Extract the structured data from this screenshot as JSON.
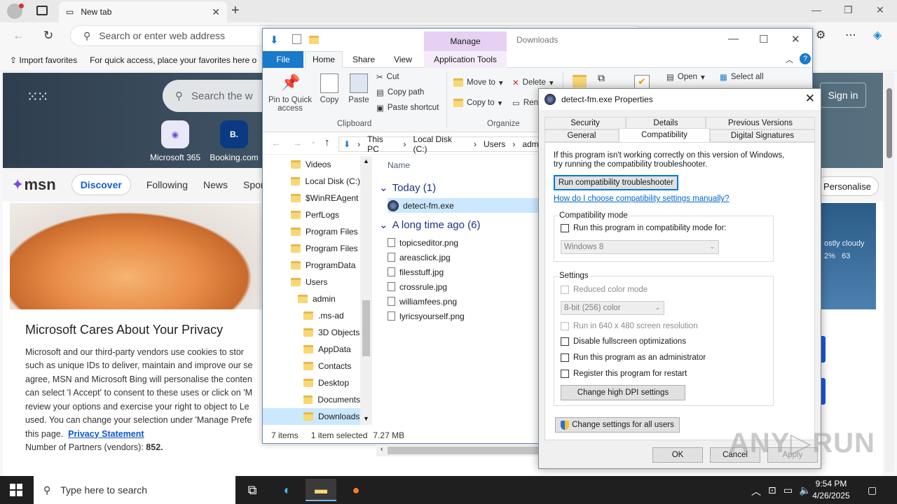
{
  "browser": {
    "tab_title": "New tab",
    "omnibox_placeholder": "Search or enter web address",
    "favorites": [
      "Import favorites",
      "For quick access, place your favorites here o"
    ]
  },
  "msn": {
    "search_placeholder": "Search the w",
    "signin": "Sign in",
    "tiles": [
      {
        "label": "Microsoft 365",
        "glyph": "◉",
        "color": "#6a4fd6"
      },
      {
        "label": "Booking.com",
        "glyph": "B.",
        "color": "#0c3a82"
      }
    ],
    "logo": "msn",
    "nav": {
      "discover": "Discover",
      "following": "Following",
      "news": "News",
      "sports": "Sports"
    },
    "personalise": "Personalise",
    "weather": {
      "desc": "ostly cloudy",
      "precip": "2%",
      "aq": "63"
    },
    "privacy": {
      "title": "Microsoft Cares About Your Privacy",
      "lines": [
        "Microsoft and our third-party vendors use cookies to stor",
        "such as unique IDs to deliver, maintain and improve our se",
        "agree, MSN and Microsoft Bing will personalise the conten",
        "can select 'I Accept' to consent to these uses or click on 'M",
        "review your options and exercise your right to object to Le",
        "used.  You can change your selection under 'Manage Prefe"
      ],
      "line7_prefix": "this page.",
      "statement_link": "Privacy Statement",
      "partners_label": "Number of Partners (vendors):",
      "partners_count": "852."
    }
  },
  "explorer": {
    "manage_tab": "Manage",
    "window_title": "Downloads",
    "tabs": {
      "file": "File",
      "home": "Home",
      "share": "Share",
      "view": "View",
      "app_tools": "Application Tools"
    },
    "ribbon": {
      "pin": "Pin to Quick access",
      "copy": "Copy",
      "paste": "Paste",
      "cut": "Cut",
      "copy_path": "Copy path",
      "paste_shortcut": "Paste shortcut",
      "clipboard_group": "Clipboard",
      "move_to": "Move to",
      "copy_to": "Copy to",
      "delete": "Delete",
      "rename": "Ren",
      "organize_group": "Organize",
      "open": "Open",
      "select_all": "Select all"
    },
    "breadcrumb": [
      "This PC",
      "Local Disk (C:)",
      "Users",
      "admin"
    ],
    "tree": [
      {
        "label": "Videos",
        "indent": 0
      },
      {
        "label": "Local Disk (C:)",
        "indent": 0
      },
      {
        "label": "$WinREAgent",
        "indent": 1
      },
      {
        "label": "PerfLogs",
        "indent": 1
      },
      {
        "label": "Program Files",
        "indent": 1
      },
      {
        "label": "Program Files",
        "indent": 1
      },
      {
        "label": "ProgramData",
        "indent": 1
      },
      {
        "label": "Users",
        "indent": 1
      },
      {
        "label": "admin",
        "indent": 2
      },
      {
        "label": ".ms-ad",
        "indent": 3
      },
      {
        "label": "3D Objects",
        "indent": 3
      },
      {
        "label": "AppData",
        "indent": 3
      },
      {
        "label": "Contacts",
        "indent": 3
      },
      {
        "label": "Desktop",
        "indent": 3
      },
      {
        "label": "Documents",
        "indent": 3
      },
      {
        "label": "Downloads",
        "indent": 3
      }
    ],
    "column_name": "Name",
    "group_today": "Today (1)",
    "today_files": [
      "detect-fm.exe"
    ],
    "group_older": "A long time ago (6)",
    "older_files": [
      "topicseditor.png",
      "areasclick.jpg",
      "filesstuff.jpg",
      "crossrule.jpg",
      "williamfees.png",
      "lyricsyourself.png"
    ],
    "status": {
      "items": "7 items",
      "selected": "1 item selected",
      "size": "7.27 MB"
    }
  },
  "props": {
    "title": "detect-fm.exe Properties",
    "tabs_row1": [
      "Security",
      "Details",
      "Previous Versions"
    ],
    "tabs_row2": [
      "General",
      "Compatibility",
      "Digital Signatures"
    ],
    "intro": "If this program isn't working correctly on this version of Windows, try running the compatibility troubleshooter.",
    "run_troubleshooter": "Run compatibility troubleshooter",
    "manual_link": "How do I choose compatibility settings manually?",
    "compat_mode_legend": "Compatibility mode",
    "compat_mode_check": "Run this program in compatibility mode for:",
    "compat_mode_value": "Windows 8",
    "settings_legend": "Settings",
    "reduced_color": "Reduced color mode",
    "color_value": "8-bit (256) color",
    "res_640": "Run in 640 x 480 screen resolution",
    "disable_fullscreen": "Disable fullscreen optimizations",
    "run_admin": "Run this program as an administrator",
    "register_restart": "Register this program for restart",
    "dpi_button": "Change high DPI settings",
    "all_users_button": "Change settings for all users",
    "ok": "OK",
    "cancel": "Cancel",
    "apply": "Apply"
  },
  "taskbar": {
    "search_placeholder": "Type here to search",
    "time": "9:54 PM",
    "date": "4/26/2025"
  }
}
